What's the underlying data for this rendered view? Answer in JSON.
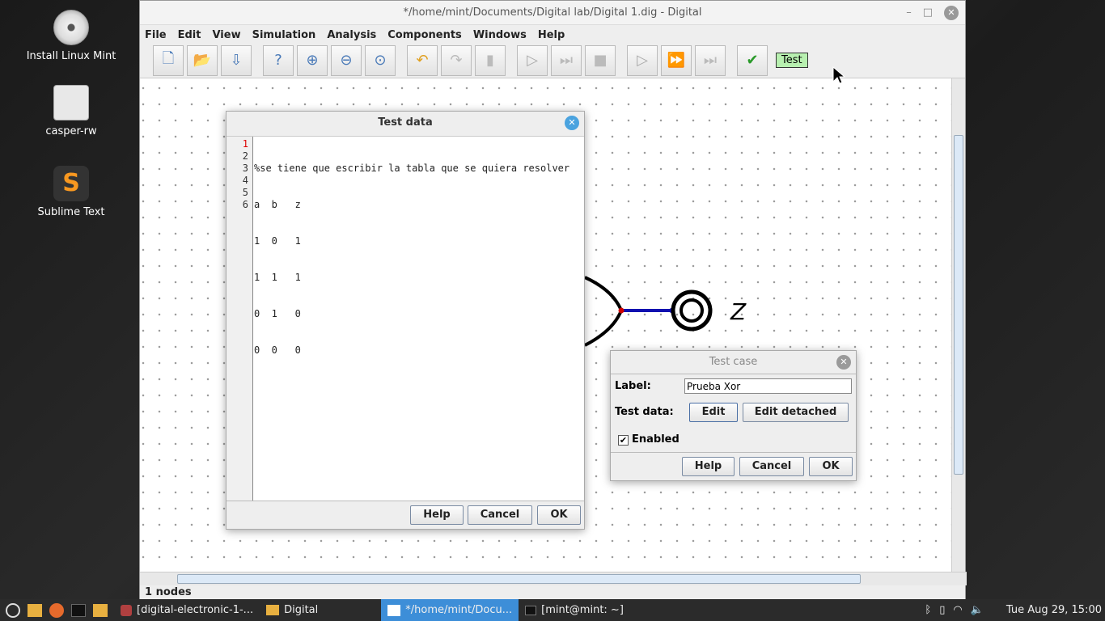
{
  "desktop": {
    "icons": [
      {
        "label": "Install Linux Mint"
      },
      {
        "label": "casper-rw"
      },
      {
        "label": "Sublime Text"
      }
    ]
  },
  "window": {
    "title": "*/home/mint/Documents/Digital lab/Digital 1.dig - Digital",
    "menu": [
      "File",
      "Edit",
      "View",
      "Simulation",
      "Analysis",
      "Components",
      "Windows",
      "Help"
    ],
    "test_button": "Test",
    "status": "1 nodes",
    "output_label": "Z"
  },
  "test_data_dialog": {
    "title": "Test data",
    "line_numbers": [
      "1",
      "2",
      "3",
      "4",
      "5",
      "6"
    ],
    "lines": [
      "%se tiene que escribir la tabla que se quiera resolver",
      "a  b   z",
      "1  0   1",
      "1  1   1",
      "0  1   0",
      "0  0   0"
    ],
    "help": "Help",
    "cancel": "Cancel",
    "ok": "OK"
  },
  "test_case_dialog": {
    "title": "Test case",
    "label_caption": "Label:",
    "label_value": "Prueba Xor",
    "test_data_caption": "Test data:",
    "edit": "Edit",
    "edit_detached": "Edit detached",
    "enabled": "Enabled",
    "enabled_checked": true,
    "help": "Help",
    "cancel": "Cancel",
    "ok": "OK"
  },
  "taskbar": {
    "tasks": [
      {
        "label": "[digital-electronic-1-..."
      },
      {
        "label": "Digital"
      },
      {
        "label": "*/home/mint/Docu..."
      },
      {
        "label": "[mint@mint: ~]"
      }
    ],
    "clock": "Tue Aug 29, 15:00"
  }
}
